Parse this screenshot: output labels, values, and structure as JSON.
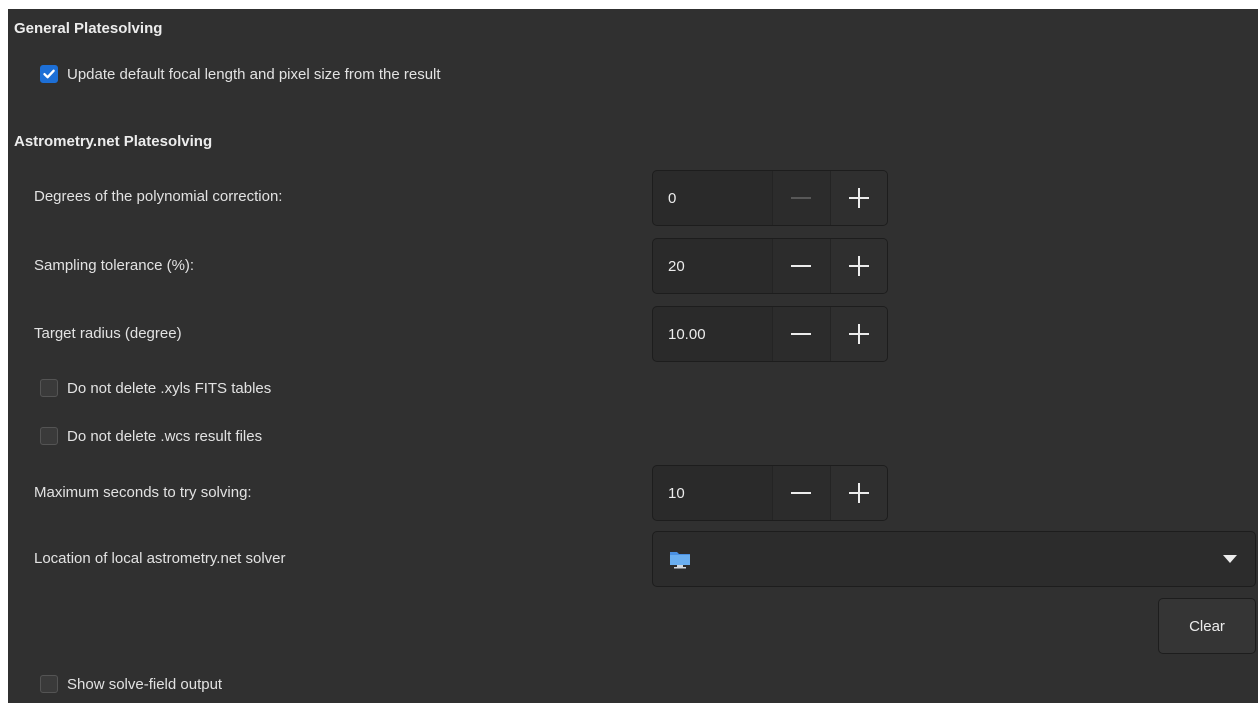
{
  "general": {
    "title": "General Platesolving",
    "update_defaults_label": "Update default focal length and pixel size from the result",
    "update_defaults_checked": true
  },
  "astrometry": {
    "title": "Astrometry.net Platesolving",
    "poly_label": "Degrees of the polynomial correction:",
    "poly_value": "0",
    "tolerance_label": "Sampling tolerance (%):",
    "tolerance_value": "20",
    "radius_label": "Target radius (degree)",
    "radius_value": "10.00",
    "keep_xyls_label": "Do not delete .xyls FITS tables",
    "keep_xyls_checked": false,
    "keep_wcs_label": "Do not delete .wcs result files",
    "keep_wcs_checked": false,
    "max_seconds_label": "Maximum seconds to try solving:",
    "max_seconds_value": "10",
    "solver_location_label": "Location of local astrometry.net solver",
    "solver_location_value": "",
    "clear_label": "Clear",
    "show_output_label": "Show solve-field output",
    "show_output_checked": false
  },
  "icons": {
    "check": "checkmark-icon",
    "minus": "minus-icon",
    "plus": "plus-icon",
    "folder": "folder-icon",
    "dropdown": "chevron-down-icon"
  },
  "colors": {
    "background": "#303030",
    "accent": "#1d6fd6",
    "text": "#e2e2e2"
  }
}
